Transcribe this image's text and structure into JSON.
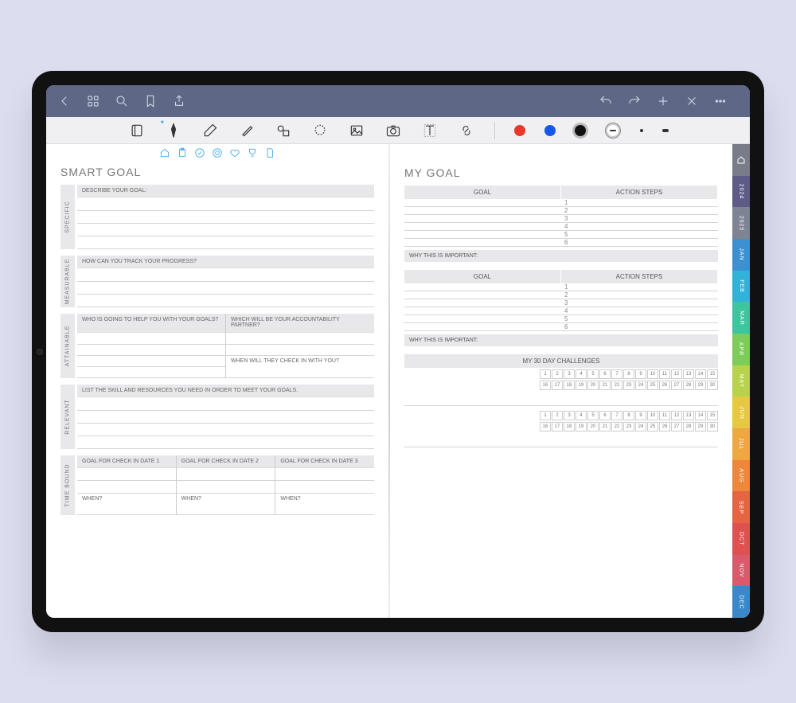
{
  "left": {
    "title": "SMART GOAL",
    "specific": {
      "label": "SPECIFIC",
      "header": "DESCRIBE YOUR GOAL:"
    },
    "measurable": {
      "label": "MEASURABLE",
      "header": "HOW CAN YOU TRACK YOUR PROGRESS?"
    },
    "attainable": {
      "label": "ATTAINABLE",
      "who": "WHO IS GOING TO HELP YOU WITH YOUR GOALS?",
      "partner": "WHICH WILL BE YOUR ACCOUNTABILITY PARTNER?",
      "check": "WHEN WILL THEY CHECK IN WITH YOU?"
    },
    "relevant": {
      "label": "RELEVANT",
      "header": "LIST THE SKILL AND RESOURCES YOU NEED IN ORDER TO MEET YOUR GOALS."
    },
    "timebound": {
      "label": "TIME BOUND",
      "g1": "GOAL FOR CHECK IN DATE 1",
      "g2": "GOAL FOR CHECK IN DATE 2",
      "g3": "GOAL FOR CHECK IN DATE 3",
      "when": "WHEN?"
    }
  },
  "right": {
    "title": "MY GOAL",
    "goal_h": "GOAL",
    "steps_h": "ACTION STEPS",
    "steps": [
      "1",
      "2",
      "3",
      "4",
      "5",
      "6"
    ],
    "important": "WHY THIS IS IMPORTANT:",
    "chall_title": "MY 30 DAY CHALLENGES",
    "days_a": [
      "1",
      "2",
      "3",
      "4",
      "5",
      "6",
      "7",
      "8",
      "9",
      "10",
      "11",
      "12",
      "13",
      "14",
      "15"
    ],
    "days_b": [
      "16",
      "17",
      "18",
      "19",
      "20",
      "21",
      "22",
      "23",
      "24",
      "25",
      "26",
      "27",
      "28",
      "29",
      "30"
    ]
  },
  "tabs": [
    {
      "label": "",
      "color": "#7a7c8a",
      "icon": "home"
    },
    {
      "label": "2024",
      "color": "#5e5c86"
    },
    {
      "label": "2025",
      "color": "#7e8493"
    },
    {
      "label": "JAN",
      "color": "#3e91d0"
    },
    {
      "label": "FEB",
      "color": "#2fb4d8"
    },
    {
      "label": "MAR",
      "color": "#3cc69f"
    },
    {
      "label": "APR",
      "color": "#7dcc5a"
    },
    {
      "label": "MAY",
      "color": "#b8d34a"
    },
    {
      "label": "JUN",
      "color": "#e6c940"
    },
    {
      "label": "JUL",
      "color": "#eda93f"
    },
    {
      "label": "AUG",
      "color": "#ed873c"
    },
    {
      "label": "SEP",
      "color": "#e66444"
    },
    {
      "label": "OCT",
      "color": "#e05050"
    },
    {
      "label": "NOV",
      "color": "#d85a6b"
    },
    {
      "label": "DEC",
      "color": "#3a88c8"
    }
  ]
}
